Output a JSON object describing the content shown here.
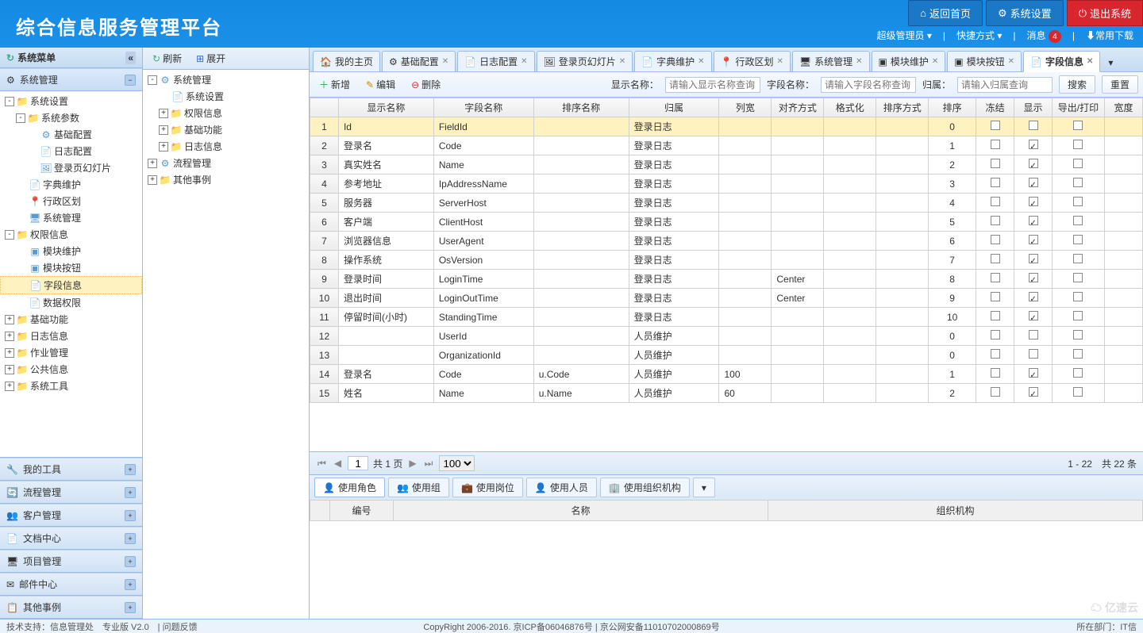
{
  "header": {
    "title": "综合信息服务管理平台",
    "btn_home": "返回首页",
    "btn_settings": "系统设置",
    "btn_exit": "退出系统",
    "user_role": "超级管理员",
    "quickway": "快捷方式",
    "msg_label": "消息",
    "msg_count": "4",
    "download": "常用下载"
  },
  "left": {
    "title": "系统菜单",
    "accordion_active": "系统管理",
    "tree": [
      {
        "exp": "-",
        "icon": "folder",
        "label": "系统设置",
        "depth": 0
      },
      {
        "exp": "-",
        "icon": "folder",
        "label": "系统参数",
        "depth": 1
      },
      {
        "exp": " ",
        "icon": "gear",
        "label": "基础配置",
        "depth": 2
      },
      {
        "exp": " ",
        "icon": "file",
        "label": "日志配置",
        "depth": 2
      },
      {
        "exp": " ",
        "icon": "image",
        "label": "登录页幻灯片",
        "depth": 2
      },
      {
        "exp": " ",
        "icon": "file",
        "label": "字典维护",
        "depth": 1
      },
      {
        "exp": " ",
        "icon": "pin",
        "label": "行政区划",
        "depth": 1
      },
      {
        "exp": " ",
        "icon": "monitor",
        "label": "系统管理",
        "depth": 1
      },
      {
        "exp": "-",
        "icon": "folder",
        "label": "权限信息",
        "depth": 0
      },
      {
        "exp": " ",
        "icon": "block",
        "label": "模块维护",
        "depth": 1
      },
      {
        "exp": " ",
        "icon": "block",
        "label": "模块按钮",
        "depth": 1
      },
      {
        "exp": " ",
        "icon": "file",
        "label": "字段信息",
        "depth": 1,
        "sel": true
      },
      {
        "exp": " ",
        "icon": "file",
        "label": "数据权限",
        "depth": 1
      },
      {
        "exp": "+",
        "icon": "folder",
        "label": "基础功能",
        "depth": 0
      },
      {
        "exp": "+",
        "icon": "folder",
        "label": "日志信息",
        "depth": 0
      },
      {
        "exp": "+",
        "icon": "folder",
        "label": "作业管理",
        "depth": 0
      },
      {
        "exp": "+",
        "icon": "folder",
        "label": "公共信息",
        "depth": 0
      },
      {
        "exp": "+",
        "icon": "folder",
        "label": "系统工具",
        "depth": 0
      }
    ],
    "accordions": [
      "我的工具",
      "流程管理",
      "客户管理",
      "文档中心",
      "项目管理",
      "邮件中心",
      "其他事例"
    ]
  },
  "mid": {
    "tb_refresh": "刷新",
    "tb_expand": "展开",
    "tree": [
      {
        "exp": "-",
        "icon": "gear",
        "label": "系统管理",
        "depth": 0
      },
      {
        "exp": " ",
        "icon": "file",
        "label": "系统设置",
        "depth": 1
      },
      {
        "exp": "+",
        "icon": "folder",
        "label": "权限信息",
        "depth": 1
      },
      {
        "exp": "+",
        "icon": "folder",
        "label": "基础功能",
        "depth": 1
      },
      {
        "exp": "+",
        "icon": "folder",
        "label": "日志信息",
        "depth": 1
      },
      {
        "exp": "+",
        "icon": "gear",
        "label": "流程管理",
        "depth": 0
      },
      {
        "exp": "+",
        "icon": "folder",
        "label": "其他事例",
        "depth": 0
      }
    ]
  },
  "tabs": [
    "我的主页",
    "基础配置",
    "日志配置",
    "登录页幻灯片",
    "字典维护",
    "行政区划",
    "系统管理",
    "模块维护",
    "模块按钮",
    "字段信息"
  ],
  "tab_active": 9,
  "main_tb": {
    "add": "新增",
    "edit": "编辑",
    "delete": "删除",
    "lbl1": "显示名称：",
    "ph1": "请输入显示名称查询",
    "lbl2": "字段名称：",
    "ph2": "请输入字段名称查询",
    "lbl3": "归属：",
    "ph3": "请输入归属查询",
    "search": "搜索",
    "reset": "重置"
  },
  "cols": [
    "显示名称",
    "字段名称",
    "排序名称",
    "归属",
    "列宽",
    "对齐方式",
    "格式化",
    "排序方式",
    "排序",
    "冻结",
    "显示",
    "导出/打印",
    "宽度"
  ],
  "rows": [
    {
      "n": 1,
      "dn": "Id",
      "fn": "FieldId",
      "sn": "",
      "gs": "登录日志",
      "lw": "",
      "al": "",
      "fm": "",
      "sm": "",
      "px": 0,
      "fz": false,
      "show": false,
      "ep": false,
      "sel": true
    },
    {
      "n": 2,
      "dn": "登录名",
      "fn": "Code",
      "sn": "",
      "gs": "登录日志",
      "lw": "",
      "al": "",
      "fm": "",
      "sm": "",
      "px": 1,
      "fz": false,
      "show": true,
      "ep": false
    },
    {
      "n": 3,
      "dn": "真实姓名",
      "fn": "Name",
      "sn": "",
      "gs": "登录日志",
      "lw": "",
      "al": "",
      "fm": "",
      "sm": "",
      "px": 2,
      "fz": false,
      "show": true,
      "ep": false
    },
    {
      "n": 4,
      "dn": "参考地址",
      "fn": "IpAddressName",
      "sn": "",
      "gs": "登录日志",
      "lw": "",
      "al": "",
      "fm": "",
      "sm": "",
      "px": 3,
      "fz": false,
      "show": true,
      "ep": false
    },
    {
      "n": 5,
      "dn": "服务器",
      "fn": "ServerHost",
      "sn": "",
      "gs": "登录日志",
      "lw": "",
      "al": "",
      "fm": "",
      "sm": "",
      "px": 4,
      "fz": false,
      "show": true,
      "ep": false
    },
    {
      "n": 6,
      "dn": "客户端",
      "fn": "ClientHost",
      "sn": "",
      "gs": "登录日志",
      "lw": "",
      "al": "",
      "fm": "",
      "sm": "",
      "px": 5,
      "fz": false,
      "show": true,
      "ep": false
    },
    {
      "n": 7,
      "dn": "浏览器信息",
      "fn": "UserAgent",
      "sn": "",
      "gs": "登录日志",
      "lw": "",
      "al": "",
      "fm": "",
      "sm": "",
      "px": 6,
      "fz": false,
      "show": true,
      "ep": false
    },
    {
      "n": 8,
      "dn": "操作系统",
      "fn": "OsVersion",
      "sn": "",
      "gs": "登录日志",
      "lw": "",
      "al": "",
      "fm": "",
      "sm": "",
      "px": 7,
      "fz": false,
      "show": true,
      "ep": false
    },
    {
      "n": 9,
      "dn": "登录时间",
      "fn": "LoginTime",
      "sn": "",
      "gs": "登录日志",
      "lw": "",
      "al": "Center",
      "fm": "",
      "sm": "",
      "px": 8,
      "fz": false,
      "show": true,
      "ep": false
    },
    {
      "n": 10,
      "dn": "退出时间",
      "fn": "LoginOutTime",
      "sn": "",
      "gs": "登录日志",
      "lw": "",
      "al": "Center",
      "fm": "",
      "sm": "",
      "px": 9,
      "fz": false,
      "show": true,
      "ep": false
    },
    {
      "n": 11,
      "dn": "停留时间(小时)",
      "fn": "StandingTime",
      "sn": "",
      "gs": "登录日志",
      "lw": "",
      "al": "",
      "fm": "",
      "sm": "",
      "px": 10,
      "fz": false,
      "show": true,
      "ep": false
    },
    {
      "n": 12,
      "dn": "",
      "fn": "UserId",
      "sn": "",
      "gs": "人员维护",
      "lw": "",
      "al": "",
      "fm": "",
      "sm": "",
      "px": 0,
      "fz": false,
      "show": false,
      "ep": false
    },
    {
      "n": 13,
      "dn": "",
      "fn": "OrganizationId",
      "sn": "",
      "gs": "人员维护",
      "lw": "",
      "al": "",
      "fm": "",
      "sm": "",
      "px": 0,
      "fz": false,
      "show": false,
      "ep": false
    },
    {
      "n": 14,
      "dn": "登录名",
      "fn": "Code",
      "sn": "u.Code",
      "gs": "人员维护",
      "lw": "100",
      "al": "",
      "fm": "",
      "sm": "",
      "px": 1,
      "fz": false,
      "show": true,
      "ep": false
    },
    {
      "n": 15,
      "dn": "姓名",
      "fn": "Name",
      "sn": "u.Name",
      "gs": "人员维护",
      "lw": "60",
      "al": "",
      "fm": "",
      "sm": "",
      "px": 2,
      "fz": false,
      "show": true,
      "ep": false
    }
  ],
  "pager": {
    "page": "1",
    "total": "共 1 页",
    "size": "100",
    "info": "1 - 22　共 22 条"
  },
  "btabs": [
    "使用角色",
    "使用组",
    "使用岗位",
    "使用人员",
    "使用组织机构"
  ],
  "bcols": [
    "编号",
    "名称",
    "组织机构"
  ],
  "footer": {
    "left": "技术支持：信息管理处　专业版 V2.0　| 问题反馈",
    "mid": "CopyRight 2006-2016. 京ICP备06046876号 | 京公网安备11010702000869号",
    "right": "所在部门：IT信"
  },
  "watermark": "亿速云"
}
